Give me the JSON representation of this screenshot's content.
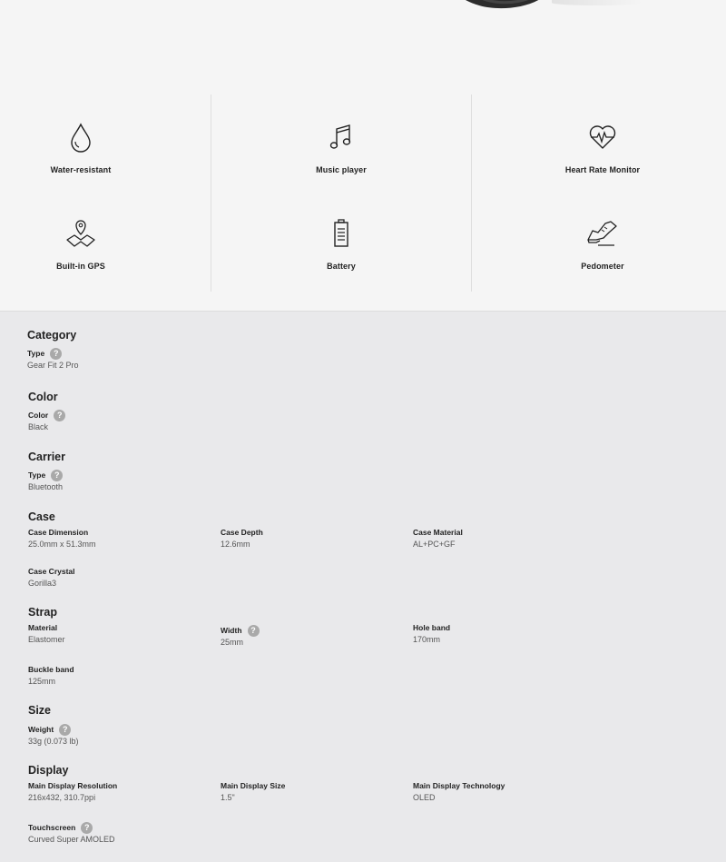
{
  "features": [
    {
      "icon": "water-drop-icon",
      "label": "Water-resistant"
    },
    {
      "icon": "music-note-icon",
      "label": "Music player"
    },
    {
      "icon": "heart-rate-icon",
      "label": "Heart Rate Monitor"
    },
    {
      "icon": "map-pin-icon",
      "label": "Built-in GPS"
    },
    {
      "icon": "battery-icon",
      "label": "Battery"
    },
    {
      "icon": "shoe-icon",
      "label": "Pedometer"
    }
  ],
  "specs": {
    "category": {
      "title": "Category",
      "type_label": "Type",
      "type_value": "Gear Fit 2 Pro"
    },
    "color": {
      "title": "Color",
      "color_label": "Color",
      "color_value": "Black"
    },
    "carrier": {
      "title": "Carrier",
      "type_label": "Type",
      "type_value": "Bluetooth"
    },
    "case": {
      "title": "Case",
      "dimension_label": "Case Dimension",
      "dimension_value": "25.0mm x 51.3mm",
      "depth_label": "Case Depth",
      "depth_value": "12.6mm",
      "material_label": "Case Material",
      "material_value": "AL+PC+GF",
      "crystal_label": "Case Crystal",
      "crystal_value": "Gorilla3"
    },
    "strap": {
      "title": "Strap",
      "material_label": "Material",
      "material_value": "Elastomer",
      "width_label": "Width",
      "width_value": "25mm",
      "hole_label": "Hole band",
      "hole_value": "170mm",
      "buckle_label": "Buckle band",
      "buckle_value": "125mm"
    },
    "size": {
      "title": "Size",
      "weight_label": "Weight",
      "weight_value": "33g (0.073 lb)"
    },
    "display": {
      "title": "Display",
      "resolution_label": "Main Display Resolution",
      "resolution_value": "216x432, 310.7ppi",
      "size_label": "Main Display Size",
      "size_value": "1.5\"",
      "tech_label": "Main Display Technology",
      "tech_value": "OLED",
      "touch_label": "Touchscreen",
      "touch_value": "Curved Super AMOLED"
    }
  },
  "help_glyph": "?"
}
